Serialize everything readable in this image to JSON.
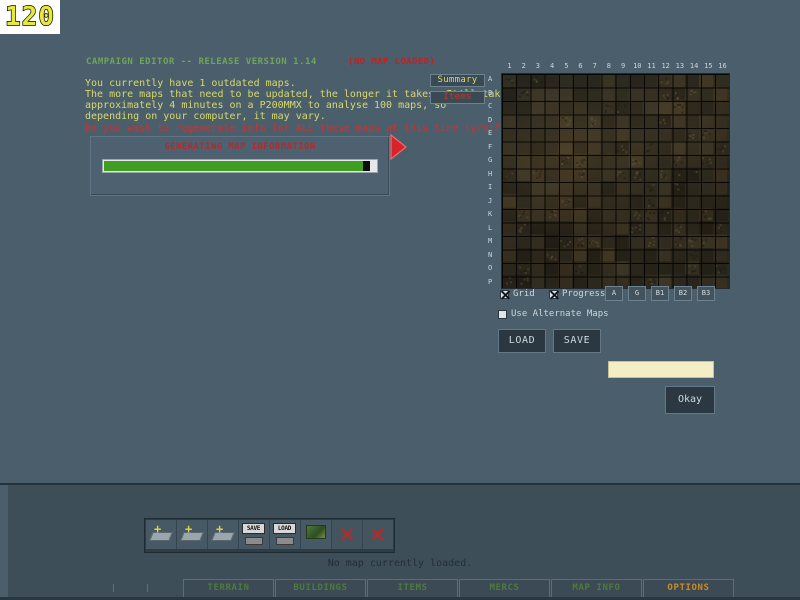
{
  "logo": {
    "text": "120"
  },
  "header": {
    "editor_title": "CAMPAIGN EDITOR -- RELEASE VERSION 1.14",
    "map_status": "(NO MAP LOADED)"
  },
  "message": {
    "line1": "You currently have 1 outdated maps.",
    "line2": "The more maps that need to be updated, the longer it takes.  It'll take",
    "line3": "approximately 4 minutes on a P200MMX to analyse 100 maps, so",
    "line4": "depending on your computer, it may vary.",
    "question": "Do you wish to regenerate info for ALL these maps at this time (y/n)?"
  },
  "progress": {
    "caption": "GENERATING MAP INFORMATION",
    "percent": 97
  },
  "side_buttons": {
    "summary": "Summary",
    "items": "Items"
  },
  "map": {
    "columns": [
      "1",
      "2",
      "3",
      "4",
      "5",
      "6",
      "7",
      "8",
      "9",
      "10",
      "11",
      "12",
      "13",
      "14",
      "15",
      "16"
    ],
    "rows": [
      "A",
      "B",
      "C",
      "D",
      "E",
      "F",
      "G",
      "H",
      "I",
      "J",
      "K",
      "L",
      "M",
      "N",
      "O",
      "P"
    ]
  },
  "options": {
    "grid": {
      "label": "Grid",
      "checked": true
    },
    "progress": {
      "label": "Progress",
      "checked": true
    },
    "alt_maps": {
      "label": "Use Alternate Maps",
      "checked": false
    }
  },
  "layer_buttons": [
    "A",
    "G",
    "B1",
    "B2",
    "B3"
  ],
  "file_buttons": {
    "load": "LOAD",
    "save": "SAVE"
  },
  "text_field": {
    "value": ""
  },
  "okay_button": {
    "label": "Okay"
  },
  "toolbar": {
    "items": [
      {
        "name": "new-map-1",
        "kind": "map-plus",
        "label": ""
      },
      {
        "name": "new-map-2",
        "kind": "map-plus",
        "label": ""
      },
      {
        "name": "new-map-3",
        "kind": "map-plus",
        "label": ""
      },
      {
        "name": "save-map",
        "kind": "floppy",
        "label": "SAVE"
      },
      {
        "name": "load-map",
        "kind": "floppy",
        "label": "LOAD"
      },
      {
        "name": "preview-map",
        "kind": "green-map",
        "label": ""
      },
      {
        "name": "delete-1",
        "kind": "x",
        "label": ""
      },
      {
        "name": "delete-2",
        "kind": "x",
        "label": ""
      }
    ]
  },
  "status": {
    "text": "No map currently loaded."
  },
  "tabs": [
    {
      "label": "TERRAIN",
      "active": false
    },
    {
      "label": "BUILDINGS",
      "active": false
    },
    {
      "label": "ITEMS",
      "active": false
    },
    {
      "label": "MERCS",
      "active": false
    },
    {
      "label": "MAP INFO",
      "active": false
    },
    {
      "label": "OPTIONS",
      "active": true
    }
  ],
  "colors": {
    "background": "#4a5e6b",
    "panel_lower": "#3e4e59",
    "title_green": "#6ea65a",
    "alert_red": "#c61f1f",
    "body_yellow": "#d9d96a",
    "question_red": "#c93434",
    "progress_green": "#3f9e22",
    "tab_active": "#d08a1e",
    "logo_yellow": "#e8e83a"
  }
}
